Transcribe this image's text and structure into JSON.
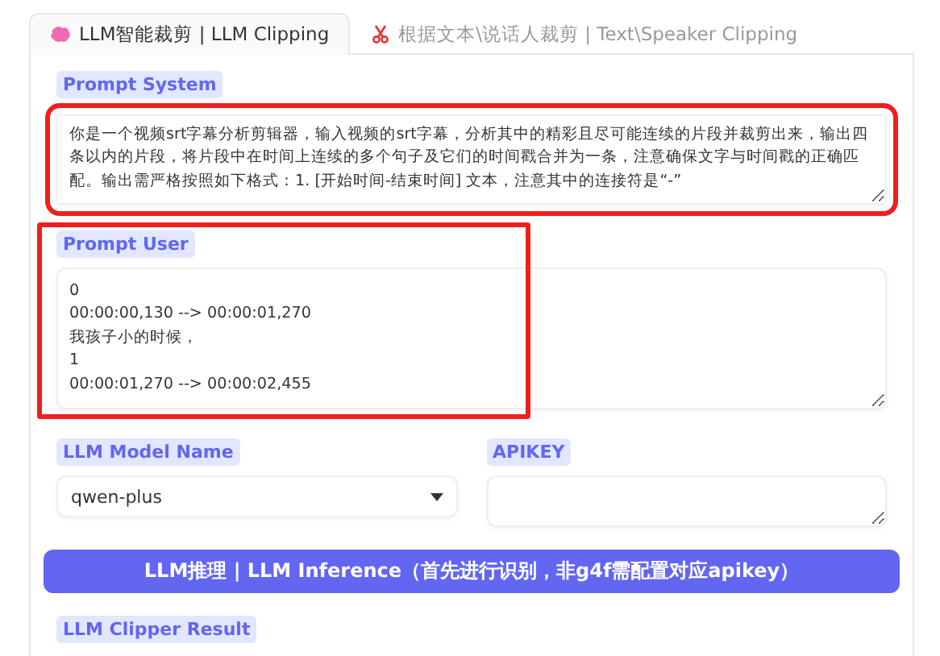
{
  "tabs": [
    {
      "label": "LLM智能裁剪 | LLM Clipping",
      "selected": true
    },
    {
      "label": "根据文本\\说话人裁剪 | Text\\Speaker Clipping",
      "selected": false
    }
  ],
  "prompt_system": {
    "label": "Prompt System",
    "value": "你是一个视频srt字幕分析剪辑器，输入视频的srt字幕，分析其中的精彩且尽可能连续的片段并裁剪出来，输出四条以内的片段，将片段中在时间上连续的多个句子及它们的时间戳合并为一条，注意确保文字与时间戳的正确匹配。输出需严格按照如下格式：1. [开始时间-结束时间] 文本，注意其中的连接符是“-”",
    "highlighted": true
  },
  "prompt_user": {
    "label": "Prompt User",
    "value": "0\n00:00:00,130 --> 00:00:01,270\n我孩子小的时候，\n1\n00:00:01,270 --> 00:00:02,455",
    "highlighted": true
  },
  "model_name": {
    "label": "LLM Model Name",
    "value": "qwen-plus"
  },
  "apikey": {
    "label": "APIKEY"
  },
  "inference_button": "LLM推理 | LLM Inference（首先进行识别，非g4f需配置对应apikey）",
  "result": {
    "label": "LLM Clipper Result"
  }
}
